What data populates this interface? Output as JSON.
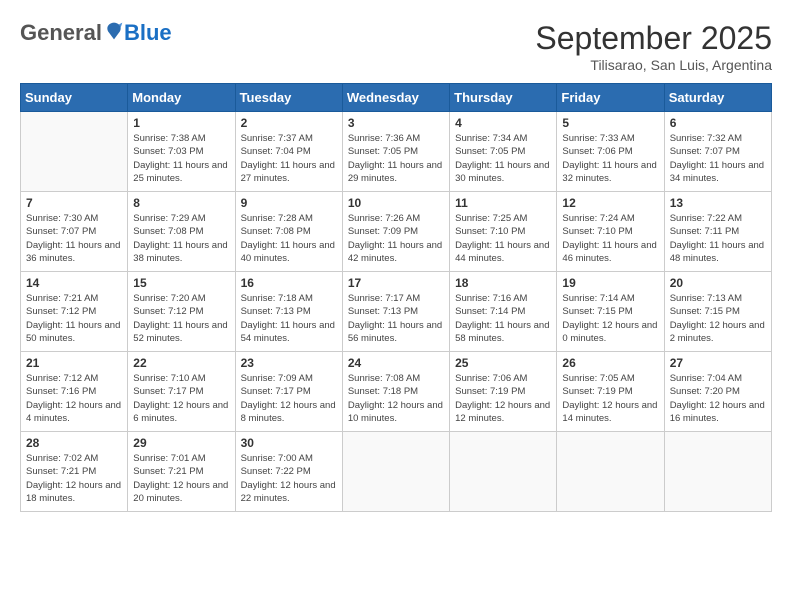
{
  "header": {
    "logo_general": "General",
    "logo_blue": "Blue",
    "month": "September 2025",
    "location": "Tilisarao, San Luis, Argentina"
  },
  "days_of_week": [
    "Sunday",
    "Monday",
    "Tuesday",
    "Wednesday",
    "Thursday",
    "Friday",
    "Saturday"
  ],
  "weeks": [
    [
      {
        "day": "",
        "info": ""
      },
      {
        "day": "1",
        "info": "Sunrise: 7:38 AM\nSunset: 7:03 PM\nDaylight: 11 hours\nand 25 minutes."
      },
      {
        "day": "2",
        "info": "Sunrise: 7:37 AM\nSunset: 7:04 PM\nDaylight: 11 hours\nand 27 minutes."
      },
      {
        "day": "3",
        "info": "Sunrise: 7:36 AM\nSunset: 7:05 PM\nDaylight: 11 hours\nand 29 minutes."
      },
      {
        "day": "4",
        "info": "Sunrise: 7:34 AM\nSunset: 7:05 PM\nDaylight: 11 hours\nand 30 minutes."
      },
      {
        "day": "5",
        "info": "Sunrise: 7:33 AM\nSunset: 7:06 PM\nDaylight: 11 hours\nand 32 minutes."
      },
      {
        "day": "6",
        "info": "Sunrise: 7:32 AM\nSunset: 7:07 PM\nDaylight: 11 hours\nand 34 minutes."
      }
    ],
    [
      {
        "day": "7",
        "info": "Sunrise: 7:30 AM\nSunset: 7:07 PM\nDaylight: 11 hours\nand 36 minutes."
      },
      {
        "day": "8",
        "info": "Sunrise: 7:29 AM\nSunset: 7:08 PM\nDaylight: 11 hours\nand 38 minutes."
      },
      {
        "day": "9",
        "info": "Sunrise: 7:28 AM\nSunset: 7:08 PM\nDaylight: 11 hours\nand 40 minutes."
      },
      {
        "day": "10",
        "info": "Sunrise: 7:26 AM\nSunset: 7:09 PM\nDaylight: 11 hours\nand 42 minutes."
      },
      {
        "day": "11",
        "info": "Sunrise: 7:25 AM\nSunset: 7:10 PM\nDaylight: 11 hours\nand 44 minutes."
      },
      {
        "day": "12",
        "info": "Sunrise: 7:24 AM\nSunset: 7:10 PM\nDaylight: 11 hours\nand 46 minutes."
      },
      {
        "day": "13",
        "info": "Sunrise: 7:22 AM\nSunset: 7:11 PM\nDaylight: 11 hours\nand 48 minutes."
      }
    ],
    [
      {
        "day": "14",
        "info": "Sunrise: 7:21 AM\nSunset: 7:12 PM\nDaylight: 11 hours\nand 50 minutes."
      },
      {
        "day": "15",
        "info": "Sunrise: 7:20 AM\nSunset: 7:12 PM\nDaylight: 11 hours\nand 52 minutes."
      },
      {
        "day": "16",
        "info": "Sunrise: 7:18 AM\nSunset: 7:13 PM\nDaylight: 11 hours\nand 54 minutes."
      },
      {
        "day": "17",
        "info": "Sunrise: 7:17 AM\nSunset: 7:13 PM\nDaylight: 11 hours\nand 56 minutes."
      },
      {
        "day": "18",
        "info": "Sunrise: 7:16 AM\nSunset: 7:14 PM\nDaylight: 11 hours\nand 58 minutes."
      },
      {
        "day": "19",
        "info": "Sunrise: 7:14 AM\nSunset: 7:15 PM\nDaylight: 12 hours\nand 0 minutes."
      },
      {
        "day": "20",
        "info": "Sunrise: 7:13 AM\nSunset: 7:15 PM\nDaylight: 12 hours\nand 2 minutes."
      }
    ],
    [
      {
        "day": "21",
        "info": "Sunrise: 7:12 AM\nSunset: 7:16 PM\nDaylight: 12 hours\nand 4 minutes."
      },
      {
        "day": "22",
        "info": "Sunrise: 7:10 AM\nSunset: 7:17 PM\nDaylight: 12 hours\nand 6 minutes."
      },
      {
        "day": "23",
        "info": "Sunrise: 7:09 AM\nSunset: 7:17 PM\nDaylight: 12 hours\nand 8 minutes."
      },
      {
        "day": "24",
        "info": "Sunrise: 7:08 AM\nSunset: 7:18 PM\nDaylight: 12 hours\nand 10 minutes."
      },
      {
        "day": "25",
        "info": "Sunrise: 7:06 AM\nSunset: 7:19 PM\nDaylight: 12 hours\nand 12 minutes."
      },
      {
        "day": "26",
        "info": "Sunrise: 7:05 AM\nSunset: 7:19 PM\nDaylight: 12 hours\nand 14 minutes."
      },
      {
        "day": "27",
        "info": "Sunrise: 7:04 AM\nSunset: 7:20 PM\nDaylight: 12 hours\nand 16 minutes."
      }
    ],
    [
      {
        "day": "28",
        "info": "Sunrise: 7:02 AM\nSunset: 7:21 PM\nDaylight: 12 hours\nand 18 minutes."
      },
      {
        "day": "29",
        "info": "Sunrise: 7:01 AM\nSunset: 7:21 PM\nDaylight: 12 hours\nand 20 minutes."
      },
      {
        "day": "30",
        "info": "Sunrise: 7:00 AM\nSunset: 7:22 PM\nDaylight: 12 hours\nand 22 minutes."
      },
      {
        "day": "",
        "info": ""
      },
      {
        "day": "",
        "info": ""
      },
      {
        "day": "",
        "info": ""
      },
      {
        "day": "",
        "info": ""
      }
    ]
  ]
}
